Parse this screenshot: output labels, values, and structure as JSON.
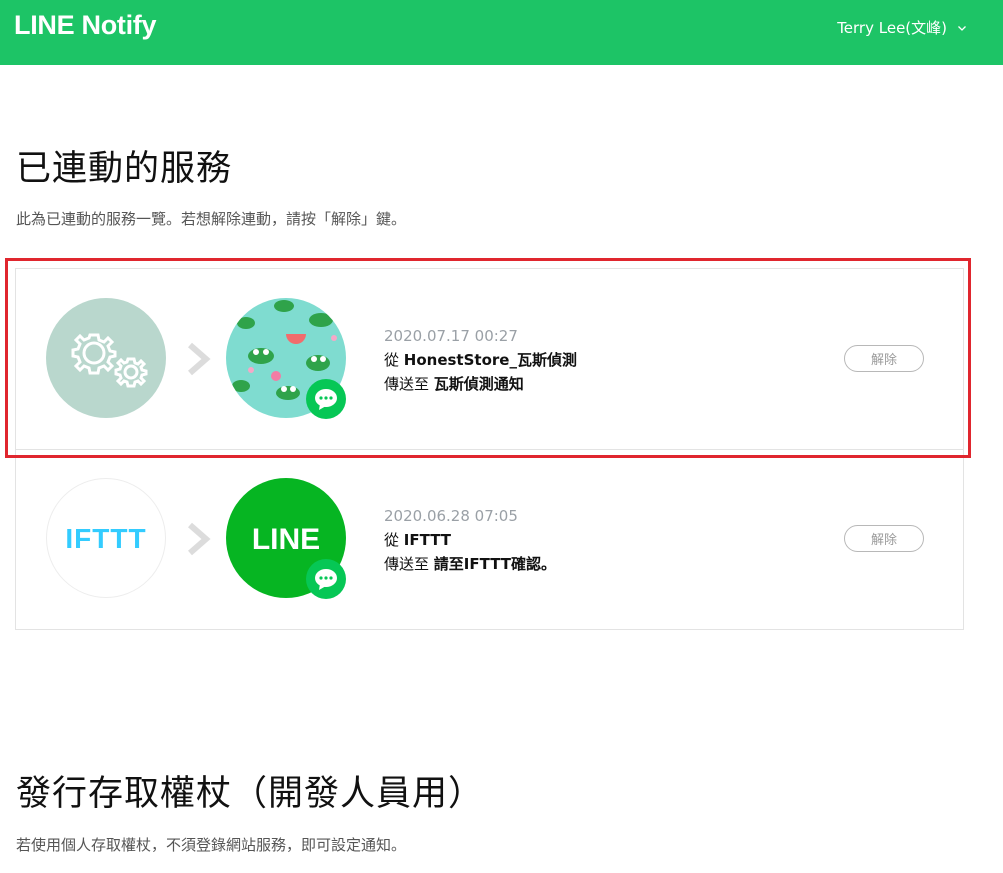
{
  "header": {
    "brand": "LINE Notify",
    "user_name": "Terry Lee(文峰)",
    "bg_color": "#1dc466"
  },
  "connected_section": {
    "title": "已連動的服務",
    "description": "此為已連動的服務一覽。若想解除連動，請按「解除」鍵。",
    "services": [
      {
        "service_icon": "gear-icon",
        "target_icon": "frog-pattern-avatar",
        "date": "2020.07.17 00:27",
        "from_prefix": "從",
        "from_name": "HonestStore_瓦斯偵測",
        "to_prefix": "傳送至",
        "to_name": "瓦斯偵測通知",
        "button_label": "解除",
        "highlighted": true
      },
      {
        "service_icon": "ifttt-logo",
        "service_logo_text": "IFTTT",
        "target_icon": "line-logo",
        "target_logo_text": "LINE",
        "date": "2020.06.28 07:05",
        "from_prefix": "從",
        "from_name": "IFTTT",
        "to_prefix": "傳送至",
        "to_name": "請至IFTTT確認。",
        "button_label": "解除",
        "highlighted": false
      }
    ]
  },
  "token_section": {
    "title": "發行存取權杖（開發人員用）",
    "description": "若使用個人存取權杖，不須登錄網站服務，即可設定通知。"
  },
  "colors": {
    "line_green": "#06c755",
    "highlight_red": "#e0262e",
    "ifttt_blue": "#33ccff"
  }
}
